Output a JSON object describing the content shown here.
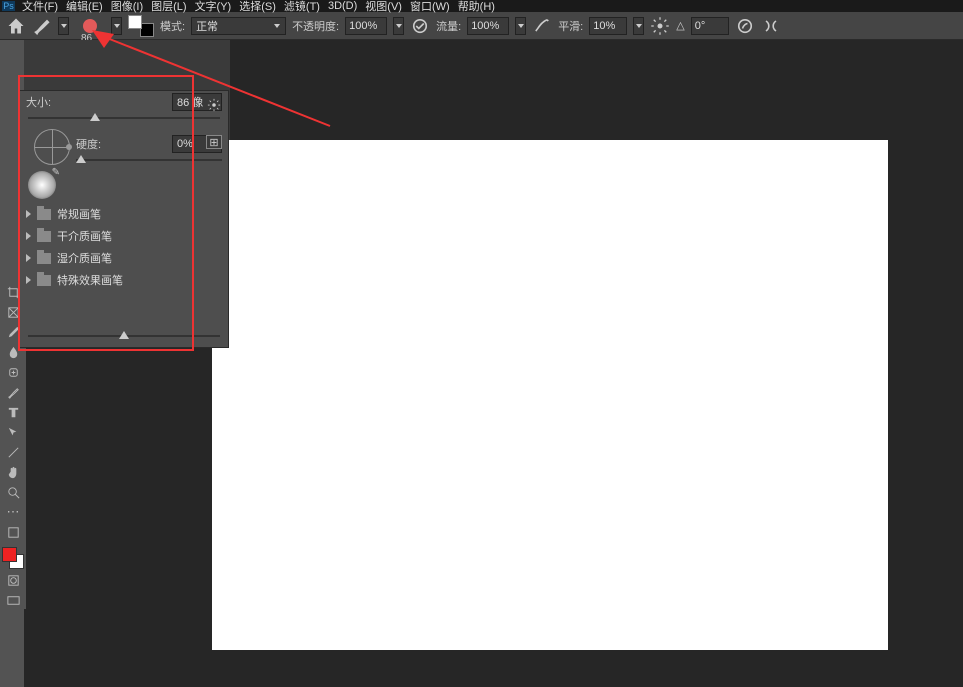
{
  "menu": {
    "items": [
      "文件(F)",
      "编辑(E)",
      "图像(I)",
      "图层(L)",
      "文字(Y)",
      "选择(S)",
      "滤镜(T)",
      "3D(D)",
      "视图(V)",
      "窗口(W)",
      "帮助(H)"
    ],
    "ps": "Ps"
  },
  "options": {
    "mode_label": "模式:",
    "mode_value": "正常",
    "opacity_label": "不透明度:",
    "opacity_value": "100%",
    "flow_label": "流量:",
    "flow_value": "100%",
    "smooth_label": "平滑:",
    "smooth_value": "10%",
    "angle_icon": "△",
    "angle_value": "0°",
    "brush_number": "86"
  },
  "popup": {
    "size_label": "大小:",
    "size_value": "86 像",
    "hardness_label": "硬度:",
    "hardness_value": "0%",
    "folders": [
      "常规画笔",
      "干介质画笔",
      "湿介质画笔",
      "特殊效果画笔"
    ]
  },
  "colors": {
    "accent_arrow": "#e33",
    "fg": "#e22",
    "bg": "#fff"
  }
}
